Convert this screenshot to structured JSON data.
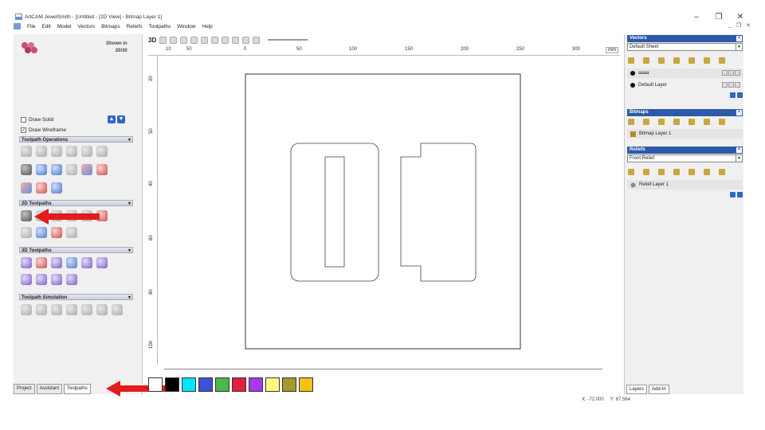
{
  "title": "ArtCAM JewelSmith - [Untitled - [2D View] - Bitmap Layer 1]",
  "window_controls": {
    "minimize": "–",
    "restore": "❐",
    "close": "✕"
  },
  "menu": [
    "File",
    "Edit",
    "Model",
    "Vectors",
    "Bitmaps",
    "Reliefs",
    "Toolpaths",
    "Window",
    "Help"
  ],
  "mdi_controls": {
    "minimize": "_",
    "restore": "❐",
    "close": "✕"
  },
  "left": {
    "shown_in": "Shown in",
    "scale": "20/30",
    "draw_solid": "Draw Solid",
    "draw_wireframe": "Draw Wireframe",
    "sections": {
      "toolpath_operations": "Toolpath Operations",
      "toolpaths_2d": "2D Toolpaths",
      "toolpaths_3d": "3D Toolpaths",
      "toolpath_simulation": "Toolpath Simulation"
    },
    "tabs": [
      "Project",
      "Assistant",
      "Toolpaths"
    ]
  },
  "view": {
    "mode_3d": "3D",
    "ruler_ticks": [
      "10",
      "50",
      "0",
      "50",
      "100",
      "150",
      "200",
      "250",
      "300"
    ],
    "vruler_ticks": [
      "20",
      "50",
      "40",
      "60",
      "80",
      "100"
    ],
    "units": "mm"
  },
  "palette": [
    "#ffffff",
    "#000000",
    "#00e5ff",
    "#3f52d6",
    "#4cb848",
    "#e02040",
    "#a43ae8",
    "#fffa80",
    "#a39b2b",
    "#f5c018"
  ],
  "right": {
    "vectors": {
      "title": "Vectors",
      "sheet": "Default Sheet",
      "layers": [
        "aaaa",
        "Default Layer"
      ]
    },
    "bitmaps": {
      "title": "Bitmaps",
      "layers": [
        "Bitmap Layer 1"
      ]
    },
    "reliefs": {
      "title": "Reliefs",
      "relief": "Front Relief",
      "layers": [
        "Relief Layer 1"
      ]
    },
    "tabs": [
      "Layers",
      "Add-In"
    ]
  },
  "status": {
    "x": "X: -72.000",
    "y": "Y: 67.564"
  }
}
